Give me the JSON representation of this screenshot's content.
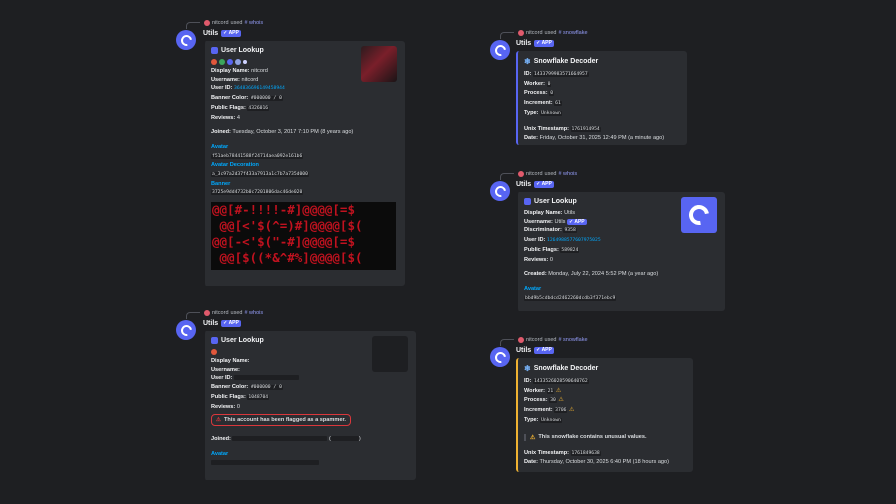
{
  "msg1": {
    "reply": {
      "user": "nitcord",
      "used": "used",
      "command": "# whois"
    },
    "author": "Utils",
    "app_tag": "✓ APP",
    "embed": {
      "title": "User Lookup",
      "display_name_label": "Display Name:",
      "display_name": "nitcord",
      "username_label": "Username:",
      "username": "nitcord",
      "user_id_label": "User ID:",
      "user_id": "364836696149458944",
      "banner_color_label": "Banner Color:",
      "banner_color": "#000000 / 0",
      "public_flags_label": "Public Flags:",
      "public_flags": "4326016",
      "reviews_label": "Reviews:",
      "reviews": "4",
      "joined_label": "Joined:",
      "joined": "Tuesday, October 3, 2017 7:10 PM (8 years ago)",
      "avatar_label": "Avatar",
      "avatar_hash": "f51aeb78441588f24714aea092e161b6",
      "avatar_decoration_label": "Avatar Decoration",
      "avatar_decoration_hash": "a_3c97a2d37f433a7913a1c7b7a735d000",
      "banner_label": "Banner",
      "banner_hash": "3725e9dd4732b0c7201806dac46de020",
      "banner_art": [
        "@@[#-!!!!-#]@@@@[=$",
        " @@[<'$(^=)#]@@@@[$(",
        "@@[-<'$(\"-#]@@@@[=$",
        " @@[$((*&^#%]@@@@[$(",
        "@@[$(('&^'#%]@@@@[=$"
      ]
    }
  },
  "msg2": {
    "reply": {
      "user": "nitcord",
      "used": "used",
      "command": "# snowflake"
    },
    "author": "Utils",
    "app_tag": "✓ APP",
    "embed": {
      "title": "Snowflake Decoder",
      "id_label": "ID:",
      "id": "1433799983571664957",
      "worker_label": "Worker:",
      "worker": "0",
      "process_label": "Process:",
      "process": "0",
      "increment_label": "Increment:",
      "increment": "61",
      "type_label": "Type:",
      "type": "Unknown",
      "unix_label": "Unix Timestamp:",
      "unix": "1761914954",
      "date_label": "Date:",
      "date": "Friday, October 31, 2025 12:49 PM (a minute ago)"
    }
  },
  "msg3": {
    "reply": {
      "user": "nitcord",
      "used": "used",
      "command": "# whois"
    },
    "author": "Utils",
    "app_tag": "✓ APP",
    "embed": {
      "title": "User Lookup",
      "display_name_label": "Display Name:",
      "display_name": "Utils",
      "username_label": "Username:",
      "username": "Utils",
      "username_tag": "✓ APP",
      "discriminator_label": "Discriminator:",
      "discriminator": "9358",
      "user_id_label": "User ID:",
      "user_id": "1264988577607975025",
      "public_flags_label": "Public Flags:",
      "public_flags": "589824",
      "reviews_label": "Reviews:",
      "reviews": "0",
      "created_label": "Created:",
      "created": "Monday, July 22, 2024 5:52 PM (a year ago)",
      "avatar_label": "Avatar",
      "avatar_hash": "bbd9b5cdbdcd2462260dcdb3f371ebc9"
    }
  },
  "msg4": {
    "reply": {
      "user": "nitcord",
      "used": "used",
      "command": "# whois"
    },
    "author": "Utils",
    "app_tag": "✓ APP",
    "embed": {
      "title": "User Lookup",
      "display_name_label": "Display Name:",
      "username_label": "Username:",
      "user_id_label": "User ID:",
      "banner_color_label": "Banner Color:",
      "banner_color": "#000000 / 0",
      "public_flags_label": "Public Flags:",
      "public_flags": "1048704",
      "reviews_label": "Reviews:",
      "reviews": "0",
      "spam_warning": "This account has been flagged as a spammer.",
      "joined_label": "Joined:",
      "joined_paren_open": "(",
      "joined_paren_close": ")",
      "avatar_label": "Avatar"
    }
  },
  "msg5": {
    "reply": {
      "user": "nitcord",
      "used": "used",
      "command": "# snowflake"
    },
    "author": "Utils",
    "app_tag": "✓ APP",
    "embed": {
      "title": "Snowflake Decoder",
      "id_label": "ID:",
      "id": "1433526028590640762",
      "worker_label": "Worker:",
      "worker": "21",
      "process_label": "Process:",
      "process": "30",
      "increment_label": "Increment:",
      "increment": "3706",
      "type_label": "Type:",
      "type": "Unknown",
      "warning": "This snowflake contains unusual values.",
      "unix_label": "Unix Timestamp:",
      "unix": "1761849638",
      "date_label": "Date:",
      "date": "Thursday, October 30, 2025 6:40 PM (18 hours ago)"
    }
  },
  "colors": {
    "background": "#1e1f22",
    "embed": "#2b2d31",
    "accent": "#5865f2",
    "link": "#00a8fc",
    "danger": "#da373c",
    "warning": "#f0b232"
  },
  "icons": [
    "discord-bot-avatar",
    "snowflake-icon",
    "warning-icon",
    "lookup-icon"
  ]
}
